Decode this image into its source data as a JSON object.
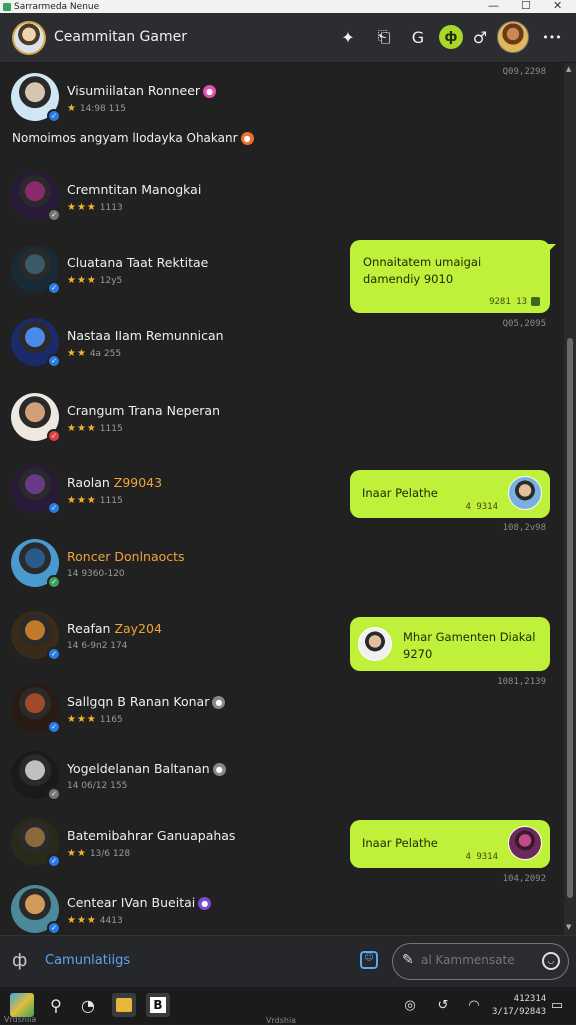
{
  "window": {
    "title": "Sarrarmeda Nenue",
    "controls": [
      "—",
      "☐",
      "✕"
    ]
  },
  "header": {
    "title": "Ceammitan Gamer",
    "icons": [
      "star-badge-icon",
      "book-icon",
      "refresh-g-icon",
      "green-p-icon",
      "link-icon",
      "user-avatar",
      "more-icon"
    ],
    "icon_glyphs": {
      "star": "✦",
      "book": "⎗",
      "refresh": "G",
      "green": "ф",
      "link": "♂",
      "more": "•••"
    }
  },
  "notice": {
    "text": "Nomoimos angyam lIodayka Ohakanr",
    "badge_color": "#e8742a"
  },
  "timestamps": [
    "Q09,2298",
    "Q05,2095",
    "108,2v98",
    "1081,2139",
    "104,2092"
  ],
  "contacts": [
    {
      "name": "Visumiilatan Ronneer",
      "highlight": "",
      "sub": "14:98 115",
      "stars": "★",
      "dot_color": "#e84fb0",
      "badge": "blue",
      "face": "#d8c5b0",
      "bg": "#cfe6f5"
    },
    {
      "name": "Cremntitan Manogkai",
      "highlight": "",
      "sub": "1113",
      "stars": "★★★",
      "dot_color": "",
      "badge": "grey",
      "face": "#8a2a6a",
      "bg": "#2a1a3a"
    },
    {
      "name": "Cluatana Taat Rektitae",
      "highlight": "",
      "sub": "12y5",
      "stars": "★★★",
      "dot_color": "",
      "badge": "blue",
      "face": "#3a5a6a",
      "bg": "#182a36"
    },
    {
      "name": "Nastaa IIam Remunnican",
      "highlight": "",
      "sub": "4a 255",
      "stars": "★★",
      "dot_color": "",
      "badge": "blue",
      "face": "#4a8ae8",
      "bg": "#1a2a6a"
    },
    {
      "name": "Crangum Trana Neperan",
      "highlight": "",
      "sub": "1115",
      "stars": "★★★",
      "dot_color": "",
      "badge": "red",
      "face": "#d0a07a",
      "bg": "#eee8e0"
    },
    {
      "name": "Raolan ",
      "highlight": "Z99043",
      "sub": "1115",
      "stars": "★★★",
      "dot_color": "",
      "badge": "blue",
      "face": "#6a3a8a",
      "bg": "#2a1a3a"
    },
    {
      "name": "",
      "highlight": "Roncer Donlnaocts",
      "sub": "14 9360-120",
      "stars": "",
      "dot_color": "",
      "badge": "green",
      "face": "#2a5a8a",
      "bg": "#4a9ad0"
    },
    {
      "name": "Reafan ",
      "highlight": "Zay204",
      "sub": "14 6-9n2 174",
      "stars": "",
      "dot_color": "",
      "badge": "blue",
      "face": "#c07a2a",
      "bg": "#3a2a1a"
    },
    {
      "name": "Sallgqn B Ranan Konar",
      "highlight": "",
      "sub": "1165",
      "stars": "★★★",
      "dot_color": "#888888",
      "badge": "blue",
      "face": "#a04a2a",
      "bg": "#2a1a14"
    },
    {
      "name": "Yogeldelanan Baltanan",
      "highlight": "",
      "sub": "14 06/12 155",
      "stars": "",
      "dot_color": "#888888",
      "badge": "grey",
      "face": "#c0c0c0",
      "bg": "#1a1a1a"
    },
    {
      "name": "Batemibahrar Ganuapahas",
      "highlight": "",
      "sub": "13/6 128",
      "stars": "★★",
      "dot_color": "",
      "badge": "blue",
      "face": "#8a6a3a",
      "bg": "#2a2a1a"
    },
    {
      "name": "Centear IVan Bueitai",
      "highlight": "",
      "sub": "4413",
      "stars": "★★★",
      "dot_color": "#7a4ad0",
      "badge": "blue",
      "face": "#d09a5a",
      "bg": "#4a8a9a"
    }
  ],
  "messages": [
    {
      "text": "Onnaitatem umaigai damendiy 9010",
      "time": "9281 13",
      "check": true
    },
    {
      "text": "Inaar Pelathe",
      "time": "4 9314",
      "check": false
    },
    {
      "text": "Mhar Gamenten Diakal 9270",
      "time": "",
      "check": false
    },
    {
      "text": "Inaar Pelathe",
      "time": "4 9314",
      "check": false
    }
  ],
  "bottom": {
    "label": "Camunlatiigs",
    "compose_placeholder": "al Kammensate",
    "pen_glyph": "✎",
    "left_glyph": "ф"
  },
  "taskbar": {
    "clock_time": "412314",
    "clock_date": "3/17/92843",
    "label": "Vrdshia",
    "left_label": "Vrdshlia"
  },
  "colors": {
    "accent": "#bff03a",
    "link": "#5aa6f0",
    "star": "#f5b52e",
    "background": "#212121"
  }
}
